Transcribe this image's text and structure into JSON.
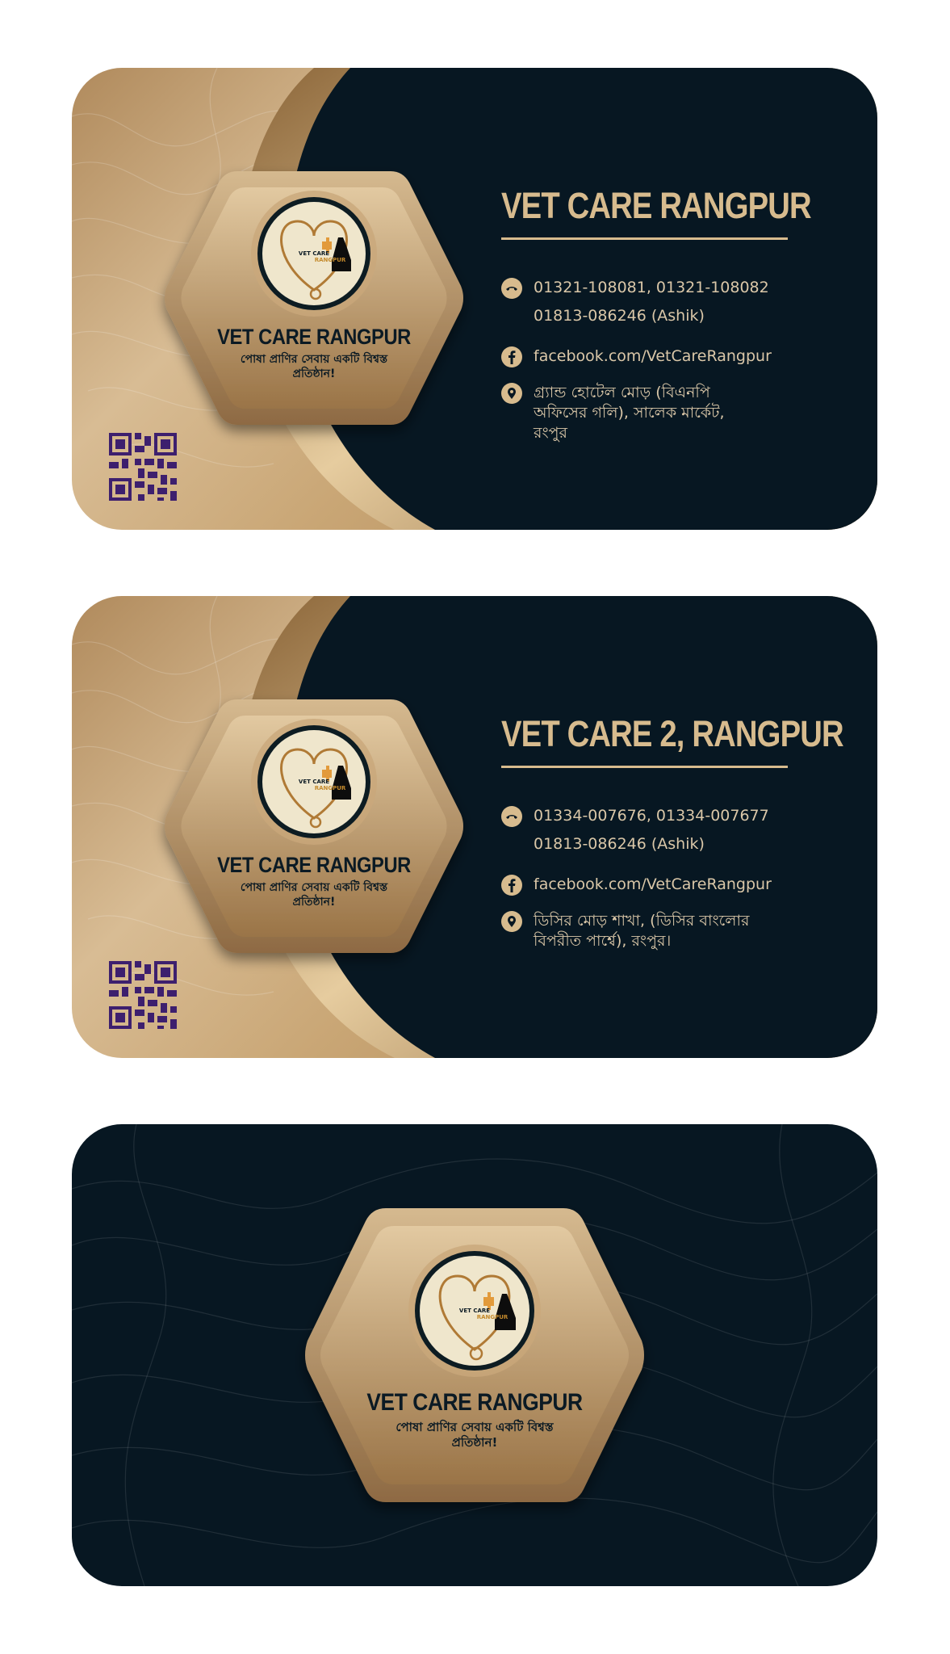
{
  "colors": {
    "gold": "#d7bb8e",
    "navy": "#071722",
    "qr": "#3d1f6e"
  },
  "logo": {
    "emblem_text": "VET CARE",
    "emblem_subtext": "RANGPUR",
    "brand": "VET CARE RANGPUR",
    "tagline_line1": "পোষা প্রাণির সেবায় একটি বিশ্বস্ত",
    "tagline_line2": "প্রতিষ্ঠান!"
  },
  "cards": [
    {
      "title": "VET CARE RANGPUR",
      "phone_line1": "01321-108081, 01321-108082",
      "phone_line2": "01813-086246 (Ashik)",
      "facebook": "facebook.com/VetCareRangpur",
      "address_line1": "গ্র্যান্ড হোটেল মোড় (বিএনপি",
      "address_line2": "অফিসের গলি), সালেক মার্কেট,",
      "address_line3": "রংপুর"
    },
    {
      "title": "VET CARE 2, RANGPUR",
      "phone_line1": "01334-007676, 01334-007677",
      "phone_line2": "01813-086246 (Ashik)",
      "facebook": "facebook.com/VetCareRangpur",
      "address_line1": "ডিসির মোড় শাখা, (ডিসির বাংলোর",
      "address_line2": "বিপরীত পার্শ্বে), রংপুর।"
    }
  ],
  "icons": [
    "phone-icon",
    "facebook-icon",
    "location-pin-icon",
    "qr-code-icon"
  ]
}
